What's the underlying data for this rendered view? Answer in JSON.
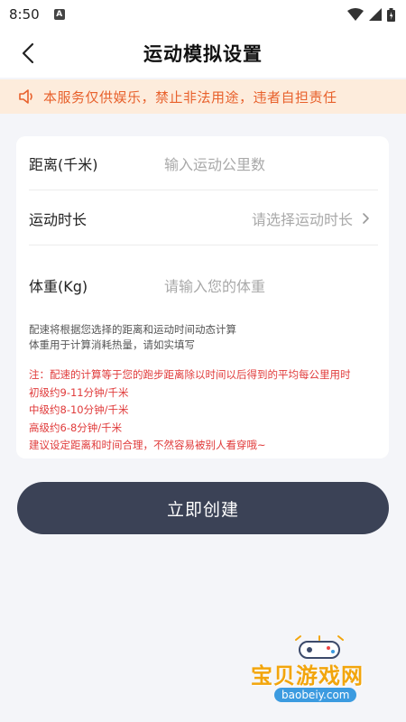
{
  "status_bar": {
    "time": "8:50",
    "badge": "A"
  },
  "header": {
    "title": "运动模拟设置"
  },
  "notice": {
    "text": "本服务仅供娱乐，禁止非法用途，违者自担责任",
    "color": "#e8612c"
  },
  "form": {
    "distance": {
      "label": "距离(千米)",
      "placeholder": "输入运动公里数"
    },
    "duration": {
      "label": "运动时长",
      "placeholder": "请选择运动时长"
    },
    "weight": {
      "label": "体重(Kg)",
      "placeholder": "请输入您的体重"
    }
  },
  "hint": [
    "配速将根据您选择的距离和运动时间动态计算",
    "体重用于计算消耗热量，请如实填写"
  ],
  "note": [
    "注：配速的计算等于您的跑步距离除以时间以后得到的平均每公里用时",
    "初级约9-11分钟/千米",
    "中级约8-10分钟/千米",
    "高级约6-8分钟/千米",
    "建议设定距离和时间合理，不然容易被别人看穿哦~"
  ],
  "actions": {
    "create_label": "立即创建",
    "button_color": "#3b4256"
  },
  "watermark": {
    "title": "宝贝游戏网",
    "url": "baobeiy.com"
  }
}
